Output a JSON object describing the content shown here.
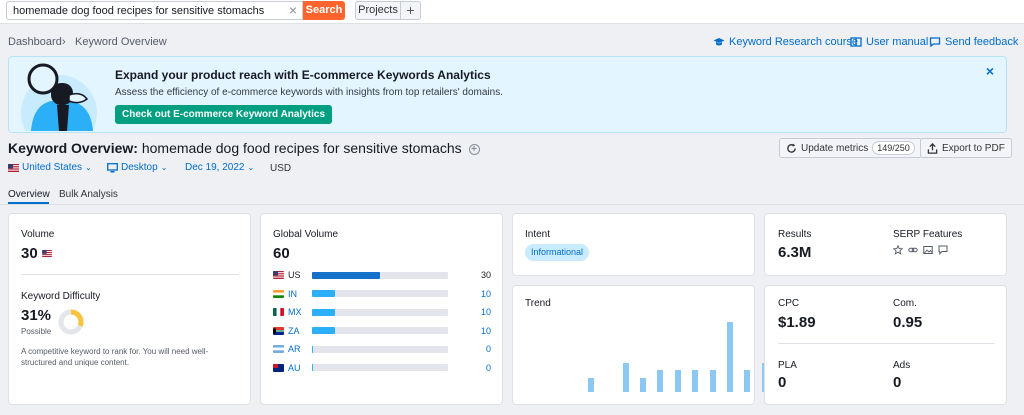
{
  "topbar": {
    "search_value": "homemade dog food recipes for sensitive stomachs",
    "clear_label": "×",
    "search_button": "Search",
    "projects_button": "Projects",
    "add_button": "+"
  },
  "breadcrumb": {
    "root": "Dashboard",
    "separator": "›",
    "current": "Keyword Overview"
  },
  "links": {
    "course": "Keyword Research course",
    "manual": "User manual",
    "feedback": "Send feedback"
  },
  "banner": {
    "title": "Expand your product reach with E-commerce Keywords Analytics",
    "text": "Assess the efficiency of e-commerce keywords with insights from top retailers' domains.",
    "cta": "Check out E-commerce Keyword Analytics",
    "close": "×"
  },
  "header": {
    "title_prefix": "Keyword Overview:",
    "keyword": "homemade dog food recipes for sensitive stomachs",
    "update_label": "Update metrics",
    "update_count": "149/250",
    "export_label": "Export to PDF"
  },
  "filters": {
    "country": "United States",
    "device": "Desktop",
    "date": "Dec 19, 2022",
    "currency": "USD"
  },
  "tabs": [
    {
      "label": "Overview"
    },
    {
      "label": "Bulk Analysis"
    }
  ],
  "volume_card": {
    "volume_label": "Volume",
    "volume_value": "30",
    "kd_label": "Keyword Difficulty",
    "kd_value": "31%",
    "kd_level": "Possible",
    "kd_percent": 31,
    "kd_note": "A competitive keyword to rank for. You will need well-structured and unique content."
  },
  "global_card": {
    "label": "Global Volume",
    "value": "60",
    "countries": [
      {
        "code": "US",
        "value": "30",
        "share": 0.5,
        "color": "#1571c9"
      },
      {
        "code": "IN",
        "value": "10",
        "share": 0.17,
        "color": "#2bb0f7"
      },
      {
        "code": "MX",
        "value": "10",
        "share": 0.17,
        "color": "#2bb0f7"
      },
      {
        "code": "ZA",
        "value": "10",
        "share": 0.17,
        "color": "#2bb0f7"
      },
      {
        "code": "AR",
        "value": "0",
        "share": 0.01,
        "color": "#2bb0f7"
      },
      {
        "code": "AU",
        "value": "0",
        "share": 0.01,
        "color": "#2bb0f7"
      }
    ]
  },
  "intent_card": {
    "label": "Intent",
    "value": "Informational"
  },
  "trend_card": {
    "label": "Trend",
    "values": [
      0,
      0,
      0.2,
      0,
      0.42,
      0.2,
      0.32,
      0.32,
      0.32,
      0.32,
      1.0,
      0.32,
      0.42
    ]
  },
  "results_card": {
    "results_label": "Results",
    "results_value": "6.3M",
    "serp_label": "SERP Features",
    "serp_icons": [
      "star-icon",
      "link-icon",
      "image-icon",
      "comment-icon"
    ]
  },
  "cpc_card": {
    "cpc_label": "CPC",
    "cpc_value": "$1.89",
    "com_label": "Com.",
    "com_value": "0.95",
    "pla_label": "PLA",
    "pla_value": "0",
    "ads_label": "Ads",
    "ads_value": "0"
  },
  "colors": {
    "accent": "#006dca",
    "search_orange": "#ff642d",
    "cta_green": "#009f81",
    "kd_yellow": "#fdc23c"
  }
}
